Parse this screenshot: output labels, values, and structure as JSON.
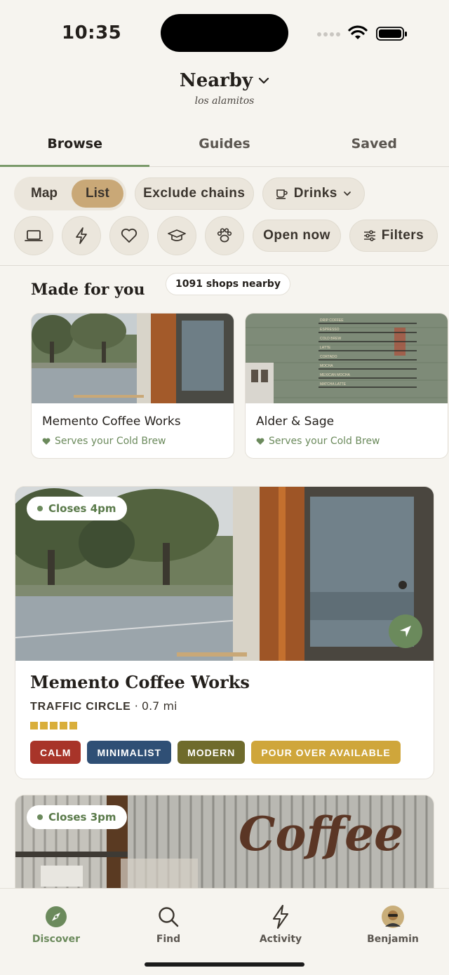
{
  "status_bar": {
    "time": "10:35"
  },
  "header": {
    "title": "Nearby",
    "subtitle": "los alamitos"
  },
  "tabs": [
    {
      "label": "Browse",
      "active": true
    },
    {
      "label": "Guides",
      "active": false
    },
    {
      "label": "Saved",
      "active": false
    }
  ],
  "view_toggle": {
    "map_label": "Map",
    "list_label": "List",
    "selected": "List"
  },
  "filters": {
    "exclude_chains_label": "Exclude chains",
    "drinks_label": "Drinks",
    "open_now_label": "Open now",
    "filters_label": "Filters",
    "icon_filters": [
      "laptop-icon",
      "bolt-icon",
      "heart-icon",
      "graduation-cap-icon",
      "paw-icon"
    ]
  },
  "made_for_you": {
    "title": "Made for you",
    "shop_count_label": "1091 shops nearby",
    "cards": [
      {
        "name": "Memento Coffee Works",
        "serves": "Serves your Cold Brew"
      },
      {
        "name": "Alder & Sage",
        "serves": "Serves your Cold Brew"
      }
    ]
  },
  "menu_board_items": [
    "DRIP COFFEE",
    "ESPRESSO",
    "COLD BREW",
    "LATTE",
    "CORTADO",
    "MOCHA",
    "MEXICAN MOCHA",
    "MATCHA LATTE"
  ],
  "shops": [
    {
      "closes": "Closes 4pm",
      "name": "Memento Coffee Works",
      "area": "TRAFFIC CIRCLE",
      "distance": "· 0.7 mi",
      "rating_squares": 5,
      "tags": [
        {
          "label": "CALM",
          "color": "#a83429"
        },
        {
          "label": "MINIMALIST",
          "color": "#2f4f75"
        },
        {
          "label": "MODERN",
          "color": "#6f6b2c"
        },
        {
          "label": "POUR OVER AVAILABLE",
          "color": "#cfa63b"
        }
      ]
    },
    {
      "closes": "Closes 3pm",
      "sign_text": "Coffee"
    }
  ],
  "bottom_nav": [
    {
      "label": "Discover",
      "icon": "compass-icon",
      "active": true
    },
    {
      "label": "Find",
      "icon": "search-icon",
      "active": false
    },
    {
      "label": "Activity",
      "icon": "bolt-icon",
      "active": false
    },
    {
      "label": "Benjamin",
      "icon": "avatar",
      "active": false
    }
  ],
  "colors": {
    "accent_green": "#6b8a5c",
    "list_tan": "#c9a877",
    "background": "#f6f4ef"
  }
}
